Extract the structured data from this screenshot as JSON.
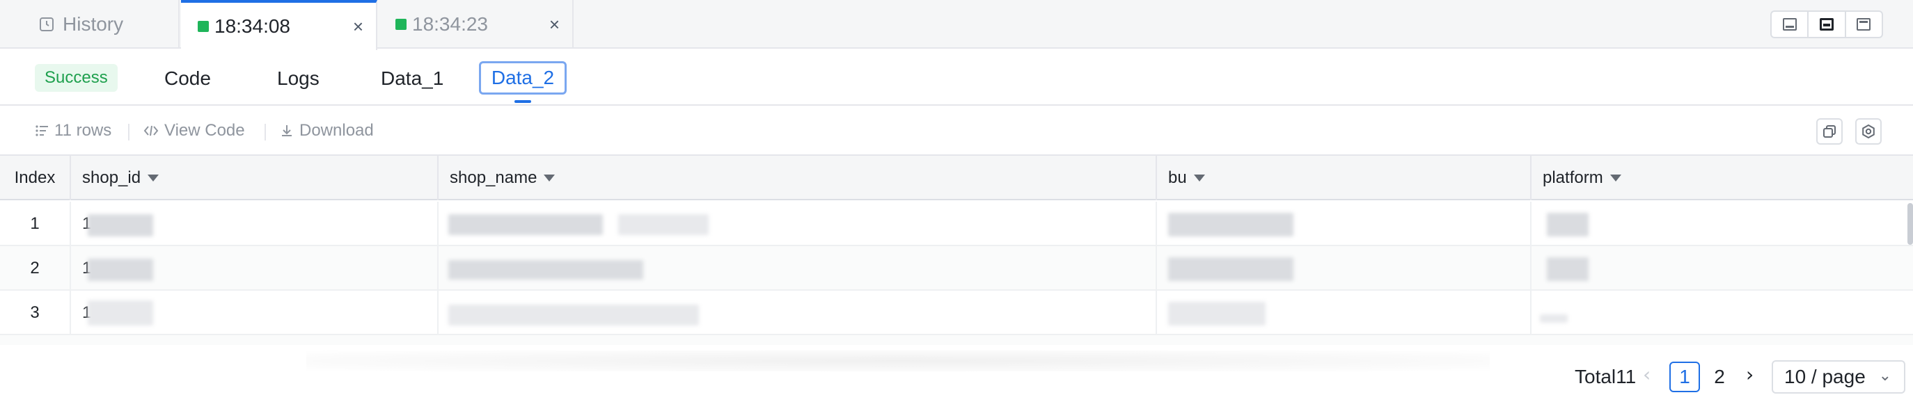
{
  "tabs": [
    {
      "label": "History",
      "icon": "history-icon"
    },
    {
      "label": "18:34:08",
      "icon": "run-status-icon",
      "status_color": "#1fb55a",
      "active": true
    },
    {
      "label": "18:34:23",
      "icon": "run-status-icon",
      "status_color": "#1fb55a",
      "active": false
    }
  ],
  "close_glyph": "×",
  "result": {
    "status": "Success",
    "tabs": [
      "Code",
      "Logs",
      "Data_1",
      "Data_2"
    ],
    "active_tab": "Data_2"
  },
  "toolbar": {
    "rows": "11 rows",
    "view_code": "View Code",
    "download": "Download"
  },
  "table": {
    "columns": [
      "Index",
      "shop_id",
      "shop_name",
      "bu",
      "platform"
    ],
    "rows": [
      {
        "index": "1",
        "shop_id": "1"
      },
      {
        "index": "2",
        "shop_id": "1"
      },
      {
        "index": "3",
        "shop_id": "1"
      }
    ]
  },
  "pagination": {
    "total": "Total11",
    "pages": [
      "1",
      "2"
    ],
    "current": "1",
    "page_size": "10 / page"
  },
  "colors": {
    "accent": "#1f6fe5",
    "success": "#1fa04e",
    "success_bg": "#e8f8ee"
  }
}
